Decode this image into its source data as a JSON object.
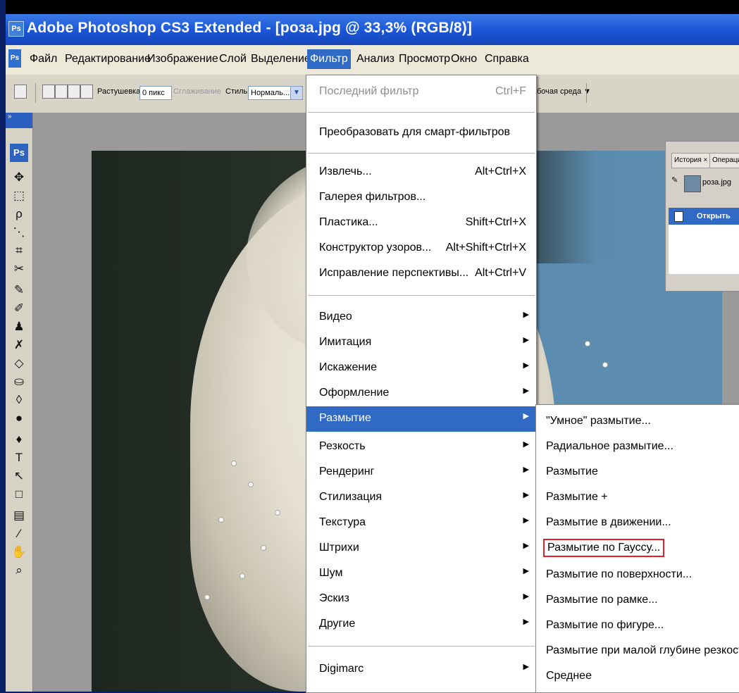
{
  "app": {
    "title": "Adobe Photoshop CS3 Extended - [роза.jpg @ 33,3% (RGB/8)]",
    "logo": "Ps"
  },
  "menubar": {
    "items": [
      "Файл",
      "Редактирование",
      "Изображение",
      "Слой",
      "Выделение",
      "Фильтр",
      "Анализ",
      "Просмотр",
      "Окно",
      "Справка"
    ],
    "active": "Фильтр"
  },
  "options": {
    "feather_label": "Растушевка:",
    "feather_value": "0 пикс",
    "antialias_label": "Сглаживание",
    "style_label": "Стиль:",
    "style_value": "Нормаль...",
    "workspace_label": "бочая среда ▼"
  },
  "toolbox": {
    "logo": "Ps",
    "tools": [
      "move-icon",
      "marquee-icon",
      "lasso-icon",
      "magic-wand-icon",
      "crop-icon",
      "slice-icon",
      "healing-icon",
      "brush-icon",
      "stamp-icon",
      "history-brush-icon",
      "eraser-icon",
      "paint-bucket-icon",
      "blur-tool-icon",
      "dodge-icon",
      "pen-icon",
      "type-icon",
      "path-select-icon",
      "shape-icon",
      "notes-icon",
      "eyedropper-icon",
      "hand-icon",
      "zoom-icon"
    ]
  },
  "history_panel": {
    "tab_history": "История ×",
    "tab_actions": "Операци",
    "snapshot_label": "роза.jpg",
    "step_label": "Открыть"
  },
  "filter_menu": {
    "last_filter": {
      "label": "Последний фильтр",
      "shortcut": "Ctrl+F"
    },
    "convert_smart": "Преобразовать для смарт-фильтров",
    "items_group1": [
      {
        "label": "Извлечь...",
        "shortcut": "Alt+Ctrl+X"
      },
      {
        "label": "Галерея фильтров...",
        "shortcut": ""
      },
      {
        "label": "Пластика...",
        "shortcut": "Shift+Ctrl+X"
      },
      {
        "label": "Конструктор узоров...",
        "shortcut": "Alt+Shift+Ctrl+X"
      },
      {
        "label": "Исправление перспективы...",
        "shortcut": "Alt+Ctrl+V"
      }
    ],
    "submenus": [
      "Видео",
      "Имитация",
      "Искажение",
      "Оформление",
      "Размытие",
      "Резкость",
      "Рендеринг",
      "Стилизация",
      "Текстура",
      "Штрихи",
      "Шум",
      "Эскиз",
      "Другие"
    ],
    "highlighted": "Размытие",
    "digimarc": "Digimarc"
  },
  "blur_submenu": {
    "items": [
      "\"Умное\" размытие...",
      "Радиальное размытие...",
      "Размытие",
      "Размытие +",
      "Размытие в движении...",
      "Размытие по Гауссу...",
      "Размытие по поверхности...",
      "Размытие по рамке...",
      "Размытие по фигуре...",
      "Размытие при малой глубине резкости...",
      "Среднее"
    ],
    "highlighted_index": 5
  }
}
